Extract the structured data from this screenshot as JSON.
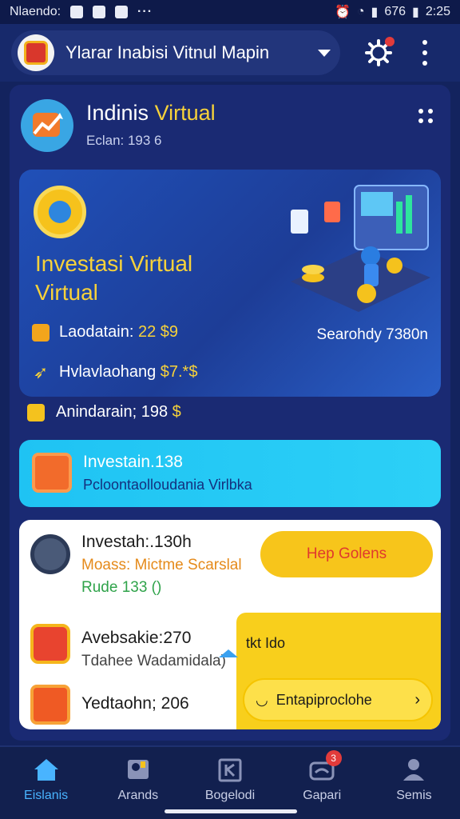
{
  "status_bar": {
    "carrier": "Nlaendo:",
    "battery": "676",
    "time": "2:25"
  },
  "app_bar": {
    "title": "Ylarar Inabisi Vitnul Mapin",
    "icons": [
      "crest-logo",
      "gear-icon",
      "more-vert-icon"
    ]
  },
  "header": {
    "title_main": "Indinis ",
    "title_accent": "Virtual",
    "subtitle": "Eclan: 193 6"
  },
  "hero": {
    "title_line1": "Investasi Virtual",
    "title_line2": "Virtual",
    "row1_label": "Laodatain: ",
    "row1_value": "22 $9",
    "row2_label": "Hvlavlaohang ",
    "row2_value": "$7.*$",
    "right_text": "Searohdy 7380n"
  },
  "line3": {
    "label": "Anindarain; 198 ",
    "value": "$"
  },
  "cyan_banner": {
    "title": "Investain.138",
    "subtitle": "Pcloontaolloudania Virlbka"
  },
  "white_card": {
    "item1_title": "Investah:.130h",
    "item1_sub1": "Moass: Mictme Scarslal",
    "item1_sub2": "Rude 133 ()",
    "button": "Hep Golens",
    "item2_title": "Avebsakie:270",
    "item2_sub": "Tdahee Wadamidala)",
    "item3_title": "Yedtaohn; 206",
    "panel_text": "tkt Ido",
    "panel_button": "Entapiproclohe"
  },
  "bottom_nav": {
    "items": [
      {
        "label": "Eislanis",
        "icon": "home-icon"
      },
      {
        "label": "Arands",
        "icon": "person-card-icon"
      },
      {
        "label": "Bogelodi",
        "icon": "k-box-icon"
      },
      {
        "label": "Gapari",
        "icon": "chat-icon"
      },
      {
        "label": "Semis",
        "icon": "profile-icon"
      }
    ],
    "badge": "3"
  },
  "colors": {
    "background": "#13235e",
    "accent_yellow": "#f7d23a",
    "accent_cyan": "#1fc3f3",
    "active_nav": "#49b4ff"
  }
}
